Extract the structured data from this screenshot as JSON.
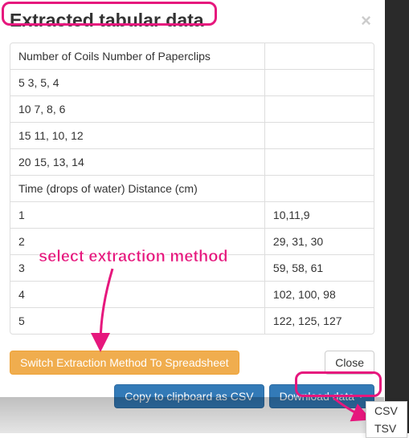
{
  "modal": {
    "title": "Extracted tabular data",
    "close": "×"
  },
  "table": {
    "rows": [
      {
        "a": "Number of Coils Number of Paperclips",
        "b": ""
      },
      {
        "a": "5 3, 5, 4",
        "b": ""
      },
      {
        "a": "10 7, 8, 6",
        "b": ""
      },
      {
        "a": "15 11, 10, 12",
        "b": ""
      },
      {
        "a": "20 15, 13, 14",
        "b": ""
      },
      {
        "a": "Time (drops of water) Distance (cm)",
        "b": ""
      },
      {
        "a": "1",
        "b": "10,11,9"
      },
      {
        "a": "2",
        "b": "29, 31, 30"
      },
      {
        "a": "3",
        "b": "59, 58, 61"
      },
      {
        "a": "4",
        "b": "102, 100, 98"
      },
      {
        "a": "5",
        "b": "122, 125, 127"
      }
    ]
  },
  "buttons": {
    "switch": "Switch Extraction Method To Spreadsheet",
    "close": "Close",
    "copy": "Copy to clipboard as CSV",
    "download": "Download data"
  },
  "dropdown": {
    "csv": "CSV",
    "tsv": "TSV"
  },
  "annotation": {
    "text": "select extraction method"
  },
  "colors": {
    "highlight": "#e6177d",
    "warning": "#f0ad4e",
    "primary": "#337ab7"
  }
}
